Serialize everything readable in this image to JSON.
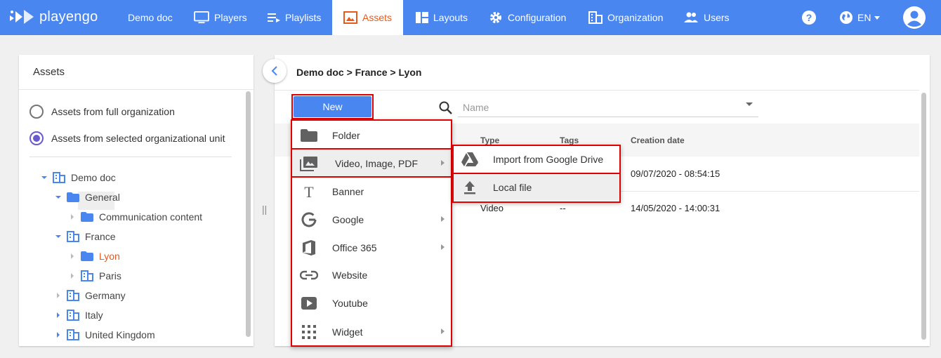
{
  "brand": {
    "name": "playengo"
  },
  "nav": {
    "demo_doc": "Demo doc",
    "players": "Players",
    "playlists": "Playlists",
    "assets": "Assets",
    "layouts": "Layouts",
    "configuration": "Configuration",
    "organization": "Organization",
    "users": "Users",
    "language": "EN"
  },
  "left_panel": {
    "title": "Assets",
    "radio_full": "Assets from full organization",
    "radio_selected": "Assets from selected organizational unit",
    "selected_radio": "radio_selected",
    "tree": {
      "demo_doc": "Demo doc",
      "general": "General",
      "communication_content": "Communication content",
      "france": "France",
      "lyon": "Lyon",
      "paris": "Paris",
      "germany": "Germany",
      "italy": "Italy",
      "united_kingdom": "United Kingdom"
    }
  },
  "right_panel": {
    "breadcrumb": "Demo doc > France > Lyon",
    "new_button": "New",
    "search_placeholder": "Name",
    "columns": {
      "type": "Type",
      "tags": "Tags",
      "creation_date": "Creation date"
    },
    "rows": [
      {
        "type": "",
        "tags": "",
        "creation_date": "09/07/2020 - 08:54:15"
      },
      {
        "type": "Video",
        "tags": "--",
        "creation_date": "14/05/2020 - 14:00:31"
      }
    ]
  },
  "new_menu": {
    "folder": "Folder",
    "video_image_pdf": "Video, Image, PDF",
    "banner": "Banner",
    "google": "Google",
    "office365": "Office 365",
    "website": "Website",
    "youtube": "Youtube",
    "widget": "Widget"
  },
  "submenu": {
    "google_drive": "Import from Google Drive",
    "local_file": "Local file"
  },
  "colors": {
    "primary": "#4a86f0",
    "active_accent": "#e8591a",
    "highlight_outline": "#e00000",
    "tree_icon": "#4a86f0"
  }
}
